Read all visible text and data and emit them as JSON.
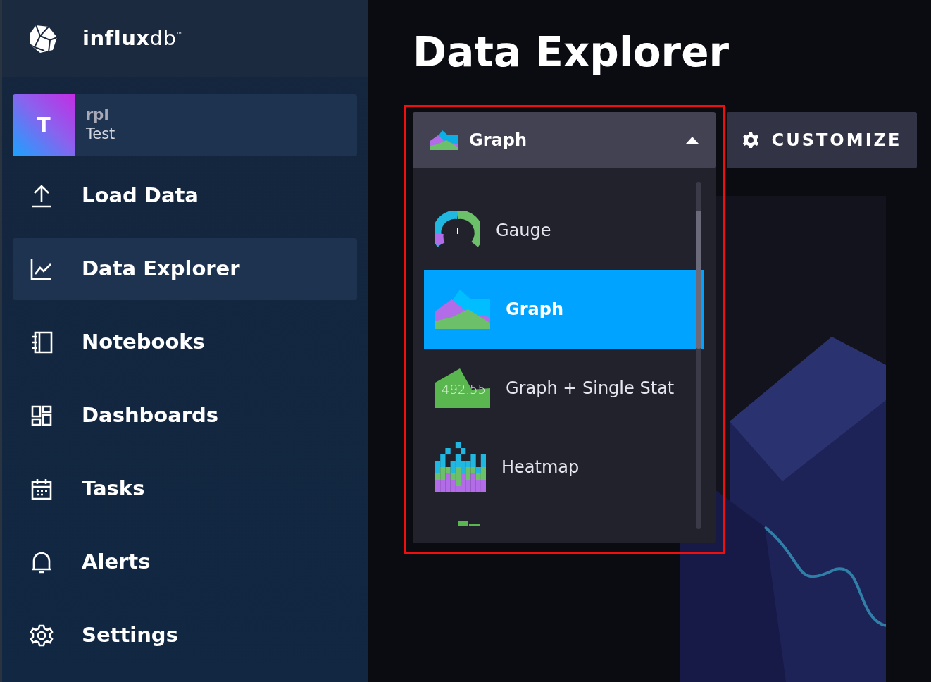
{
  "logo": {
    "word_bold": "influx",
    "word_light": "db",
    "mark": "™"
  },
  "org": {
    "initial": "T",
    "account": "rpi",
    "name": "Test"
  },
  "nav": [
    {
      "kind": "upload",
      "label": "Load Data",
      "selected": false
    },
    {
      "kind": "chart",
      "label": "Data Explorer",
      "selected": true
    },
    {
      "kind": "notebook",
      "label": "Notebooks",
      "selected": false
    },
    {
      "kind": "dashboards",
      "label": "Dashboards",
      "selected": false
    },
    {
      "kind": "calendar",
      "label": "Tasks",
      "selected": false
    },
    {
      "kind": "bell",
      "label": "Alerts",
      "selected": false
    },
    {
      "kind": "gear",
      "label": "Settings",
      "selected": false
    }
  ],
  "page_title": "Data Explorer",
  "type_dropdown": {
    "value": "Graph",
    "expanded": true,
    "highlighted": true,
    "options": [
      {
        "kind": "gauge",
        "label": "Gauge",
        "selected": false
      },
      {
        "kind": "graph",
        "label": "Graph",
        "selected": true
      },
      {
        "kind": "single_stat",
        "label": "Graph + Single Stat",
        "icon_text": "492.55",
        "selected": false
      },
      {
        "kind": "heatmap",
        "label": "Heatmap",
        "selected": false
      },
      {
        "kind": "partial",
        "selected": false
      }
    ]
  },
  "customize_button": "CUSTOMIZE"
}
